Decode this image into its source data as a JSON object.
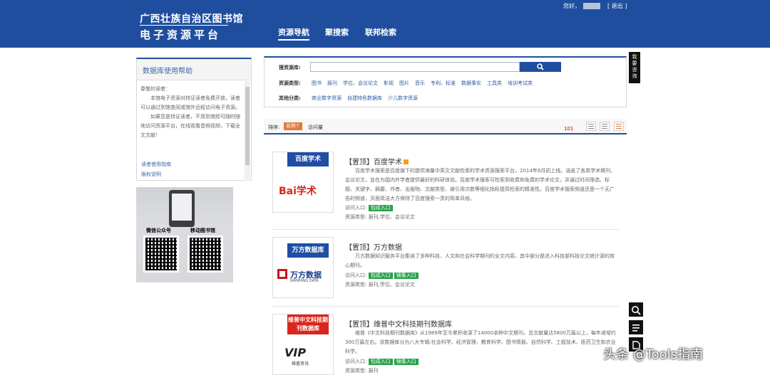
{
  "header": {
    "logo_line1": "广西壮族自治区图书馆",
    "logo_line2": "电子资源平台",
    "nav": [
      "资源导航",
      "聚搜索",
      "联邦检索"
    ],
    "greeting": "您好，",
    "logout": "[ 退出 ]"
  },
  "sidebar": {
    "help_title": "数据库使用帮助",
    "help_paragraphs": [
      "尊敬的读者：",
      "本馆电子资源对持证读者免费开放，读者可以通过到馆查阅或馆外远程访问电子资源。",
      "如果您是持证读者，不用到馆即可随时随地访问资源平台，在线观看音频视频，下载全文文献！"
    ],
    "links": [
      "读者使用指南",
      "版权说明"
    ],
    "qr_captions": [
      "微信公众号",
      "移动图书馆"
    ]
  },
  "search": {
    "label_source": "搜资源库:",
    "label_type": "资源类型:",
    "label_other": "其他分类:",
    "types": [
      "图书",
      "报刊",
      "学位、会议论文",
      "影视",
      "图片",
      "音乐",
      "专利、标准",
      "数据事实",
      "工具类",
      "培训考试类"
    ],
    "others": [
      "商业数字资源",
      "自建特色数据库",
      "少儿数字资源"
    ]
  },
  "sort": {
    "label": "排序:",
    "by_name": "名称↑",
    "by_visits": "访问量",
    "count": "101"
  },
  "entries": [
    {
      "tag": "百度学术",
      "logo_text": "Bai学术",
      "title": "【置顶】百度学术",
      "desc": "百度学术搜索是百度旗下的提供海量中英文文献检索的学术资源搜索平台，2014年6月初上线。涵盖了各类学术期刊、会议论文，旨在为国内外学者提供最好的科研体验。百度学术搜索可检索到收费和免费的学术论文，并通过时间筛选、标题、关键字、摘要、作者、出版物、文献类型、被引用次数等细化指标提高检索的精准性。百度学术搜索频道还是一个无广告的频道，页面简洁大方保持了百度搜索一贯的简单风格。",
      "access_label": "访问入口:",
      "access": [
        "包成入口"
      ],
      "type_label": "资源类型: ",
      "types": "报刊,学位、会议论文"
    },
    {
      "tag": "万方数据库",
      "logo_text": "万方数据",
      "logo_sub": "WANFANG DATA",
      "title": "【置顶】万方数据",
      "desc": "万方数据知识服务平台集纳了多种科技、人文和社会科学期刊的全文内容。其中部分是进入科技部科技论文统计源的核心期刊。",
      "access_label": "访问入口:",
      "access": [
        "包成入口",
        "镜像入口"
      ],
      "type_label": "资源类型: ",
      "types": "报刊,学位、会议论文"
    },
    {
      "tag": "维普中文科技期刊数据库",
      "logo_text": "VIP",
      "logo_sub": "维普资讯",
      "title": "【置顶】维普中文科技期刊数据库",
      "desc": "维普《中文科技期刊数据库》从1989年至今累积收录了14000余种中文期刊，总文献量达5800万篇以上，每年递增约300万篇左右。该数据库分为八大专辑:社会科学、经济管理、教育科学、图书情报、自然科学、工程技术、医药卫生和农业科学。",
      "access_label": "访问入口:",
      "access": [
        "包成入口",
        "镜像入口"
      ],
      "type_label": "资源类型: ",
      "types": "报刊"
    }
  ],
  "floating": {
    "consult": "我要咨询"
  },
  "watermark": "头条 @Tools指南"
}
